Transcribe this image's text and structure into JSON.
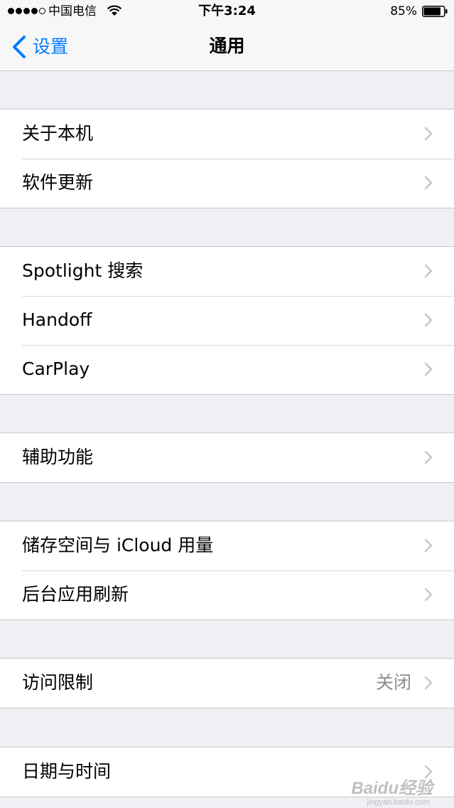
{
  "status_bar": {
    "carrier": "中国电信",
    "time": "下午3:24",
    "battery": "85%",
    "battery_level": 0.85,
    "signal_bars": 4,
    "signal_max": 5
  },
  "nav": {
    "back_label": "设置",
    "title": "通用"
  },
  "groups": [
    {
      "rows": [
        {
          "label": "关于本机"
        },
        {
          "label": "软件更新"
        }
      ]
    },
    {
      "rows": [
        {
          "label": "Spotlight 搜索"
        },
        {
          "label": "Handoff"
        },
        {
          "label": "CarPlay"
        }
      ]
    },
    {
      "rows": [
        {
          "label": "辅助功能"
        }
      ]
    },
    {
      "rows": [
        {
          "label": "储存空间与 iCloud 用量"
        },
        {
          "label": "后台应用刷新"
        }
      ]
    },
    {
      "rows": [
        {
          "label": "访问限制",
          "value": "关闭"
        }
      ]
    },
    {
      "rows": [
        {
          "label": "日期与时间"
        }
      ]
    }
  ],
  "watermark": {
    "text": "Baidu经验",
    "sub": "jingyan.baidu.com"
  },
  "colors": {
    "accent": "#007aff",
    "background": "#efeff4",
    "separator": "#c8c7cc",
    "secondary_text": "#8e8e93",
    "chevron": "#c7c7cc"
  },
  "icons": {
    "back": "chevron-left-icon",
    "disclosure": "chevron-right-icon",
    "wifi": "wifi-icon",
    "battery": "battery-icon"
  }
}
